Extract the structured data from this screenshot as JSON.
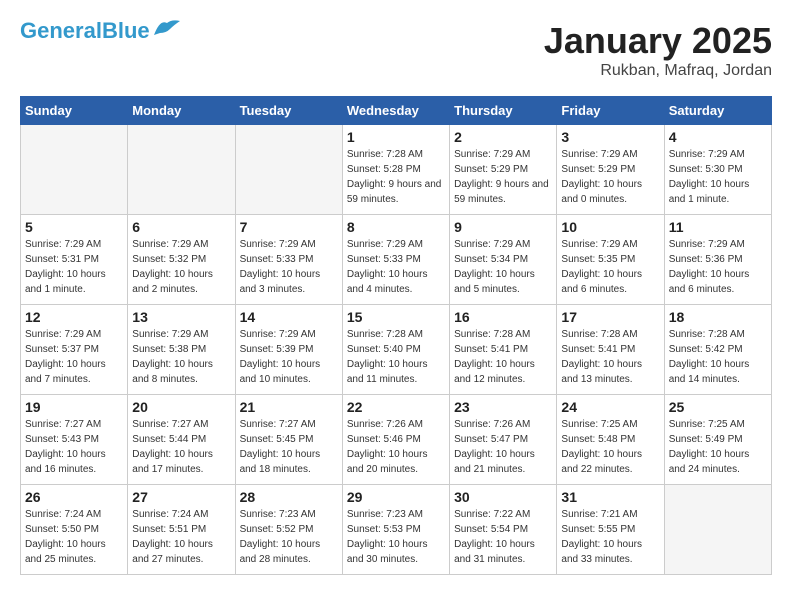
{
  "header": {
    "logo_line1": "General",
    "logo_line2": "Blue",
    "month_title": "January 2025",
    "location": "Rukban, Mafraq, Jordan"
  },
  "weekdays": [
    "Sunday",
    "Monday",
    "Tuesday",
    "Wednesday",
    "Thursday",
    "Friday",
    "Saturday"
  ],
  "weeks": [
    [
      {
        "day": "",
        "empty": true
      },
      {
        "day": "",
        "empty": true
      },
      {
        "day": "",
        "empty": true
      },
      {
        "day": "1",
        "sunrise": "7:28 AM",
        "sunset": "5:28 PM",
        "daylight": "9 hours and 59 minutes."
      },
      {
        "day": "2",
        "sunrise": "7:29 AM",
        "sunset": "5:29 PM",
        "daylight": "9 hours and 59 minutes."
      },
      {
        "day": "3",
        "sunrise": "7:29 AM",
        "sunset": "5:29 PM",
        "daylight": "10 hours and 0 minutes."
      },
      {
        "day": "4",
        "sunrise": "7:29 AM",
        "sunset": "5:30 PM",
        "daylight": "10 hours and 1 minute."
      }
    ],
    [
      {
        "day": "5",
        "sunrise": "7:29 AM",
        "sunset": "5:31 PM",
        "daylight": "10 hours and 1 minute."
      },
      {
        "day": "6",
        "sunrise": "7:29 AM",
        "sunset": "5:32 PM",
        "daylight": "10 hours and 2 minutes."
      },
      {
        "day": "7",
        "sunrise": "7:29 AM",
        "sunset": "5:33 PM",
        "daylight": "10 hours and 3 minutes."
      },
      {
        "day": "8",
        "sunrise": "7:29 AM",
        "sunset": "5:33 PM",
        "daylight": "10 hours and 4 minutes."
      },
      {
        "day": "9",
        "sunrise": "7:29 AM",
        "sunset": "5:34 PM",
        "daylight": "10 hours and 5 minutes."
      },
      {
        "day": "10",
        "sunrise": "7:29 AM",
        "sunset": "5:35 PM",
        "daylight": "10 hours and 6 minutes."
      },
      {
        "day": "11",
        "sunrise": "7:29 AM",
        "sunset": "5:36 PM",
        "daylight": "10 hours and 6 minutes."
      }
    ],
    [
      {
        "day": "12",
        "sunrise": "7:29 AM",
        "sunset": "5:37 PM",
        "daylight": "10 hours and 7 minutes."
      },
      {
        "day": "13",
        "sunrise": "7:29 AM",
        "sunset": "5:38 PM",
        "daylight": "10 hours and 8 minutes."
      },
      {
        "day": "14",
        "sunrise": "7:29 AM",
        "sunset": "5:39 PM",
        "daylight": "10 hours and 10 minutes."
      },
      {
        "day": "15",
        "sunrise": "7:28 AM",
        "sunset": "5:40 PM",
        "daylight": "10 hours and 11 minutes."
      },
      {
        "day": "16",
        "sunrise": "7:28 AM",
        "sunset": "5:41 PM",
        "daylight": "10 hours and 12 minutes."
      },
      {
        "day": "17",
        "sunrise": "7:28 AM",
        "sunset": "5:41 PM",
        "daylight": "10 hours and 13 minutes."
      },
      {
        "day": "18",
        "sunrise": "7:28 AM",
        "sunset": "5:42 PM",
        "daylight": "10 hours and 14 minutes."
      }
    ],
    [
      {
        "day": "19",
        "sunrise": "7:27 AM",
        "sunset": "5:43 PM",
        "daylight": "10 hours and 16 minutes."
      },
      {
        "day": "20",
        "sunrise": "7:27 AM",
        "sunset": "5:44 PM",
        "daylight": "10 hours and 17 minutes."
      },
      {
        "day": "21",
        "sunrise": "7:27 AM",
        "sunset": "5:45 PM",
        "daylight": "10 hours and 18 minutes."
      },
      {
        "day": "22",
        "sunrise": "7:26 AM",
        "sunset": "5:46 PM",
        "daylight": "10 hours and 20 minutes."
      },
      {
        "day": "23",
        "sunrise": "7:26 AM",
        "sunset": "5:47 PM",
        "daylight": "10 hours and 21 minutes."
      },
      {
        "day": "24",
        "sunrise": "7:25 AM",
        "sunset": "5:48 PM",
        "daylight": "10 hours and 22 minutes."
      },
      {
        "day": "25",
        "sunrise": "7:25 AM",
        "sunset": "5:49 PM",
        "daylight": "10 hours and 24 minutes."
      }
    ],
    [
      {
        "day": "26",
        "sunrise": "7:24 AM",
        "sunset": "5:50 PM",
        "daylight": "10 hours and 25 minutes."
      },
      {
        "day": "27",
        "sunrise": "7:24 AM",
        "sunset": "5:51 PM",
        "daylight": "10 hours and 27 minutes."
      },
      {
        "day": "28",
        "sunrise": "7:23 AM",
        "sunset": "5:52 PM",
        "daylight": "10 hours and 28 minutes."
      },
      {
        "day": "29",
        "sunrise": "7:23 AM",
        "sunset": "5:53 PM",
        "daylight": "10 hours and 30 minutes."
      },
      {
        "day": "30",
        "sunrise": "7:22 AM",
        "sunset": "5:54 PM",
        "daylight": "10 hours and 31 minutes."
      },
      {
        "day": "31",
        "sunrise": "7:21 AM",
        "sunset": "5:55 PM",
        "daylight": "10 hours and 33 minutes."
      },
      {
        "day": "",
        "empty": true
      }
    ]
  ],
  "labels": {
    "sunrise_label": "Sunrise:",
    "sunset_label": "Sunset:",
    "daylight_label": "Daylight:"
  }
}
